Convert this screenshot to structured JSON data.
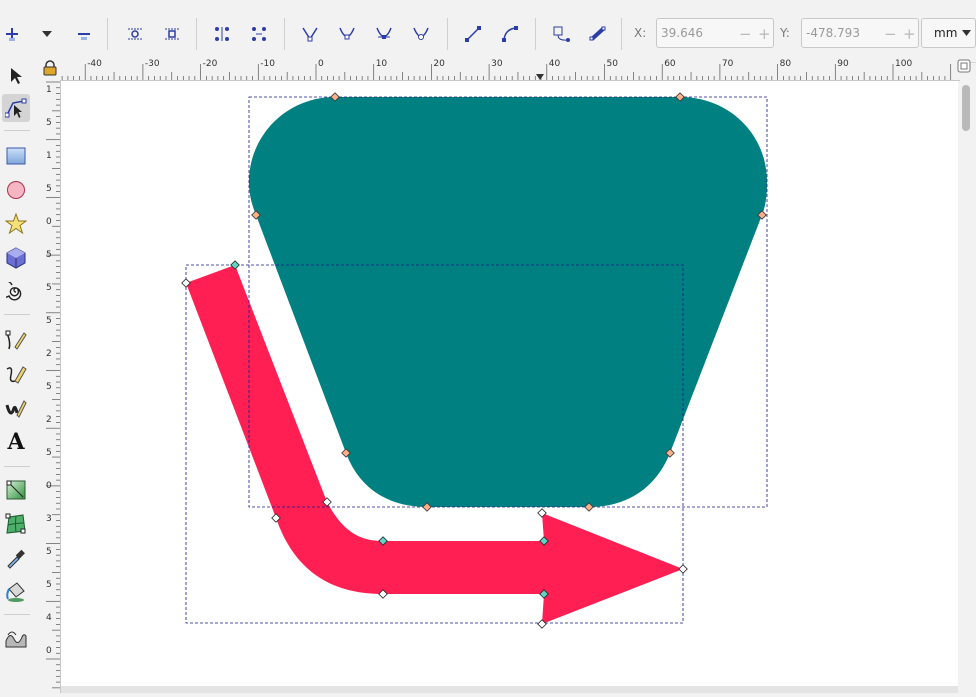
{
  "toolbar": {
    "x_label": "X:",
    "x_value": "39.646",
    "y_label": "Y:",
    "y_value": "-478.793",
    "unit": "mm",
    "buttons": [
      "insert-node",
      "dropdown",
      "delete-node",
      "join-nodes",
      "break-path",
      "join-segment",
      "delete-segment",
      "make-cusp",
      "make-smooth",
      "make-symmetric",
      "make-auto-smooth",
      "make-line",
      "make-curve",
      "object-to-path",
      "stroke-to-path"
    ]
  },
  "rulers": {
    "horizontal_labels": [
      "-40",
      "-30",
      "-20",
      "-10",
      "0",
      "10",
      "20",
      "30",
      "40",
      "50",
      "60",
      "70",
      "80",
      "90",
      "100"
    ],
    "vertical_labels": [
      "1",
      "5",
      "1",
      "5",
      "0",
      "5",
      "5",
      "5",
      "2",
      "5",
      "2",
      "5",
      "0",
      "3",
      "5",
      "5",
      "4",
      "0"
    ]
  },
  "tools": [
    {
      "name": "selector-tool",
      "active": false
    },
    {
      "name": "node-tool",
      "active": true
    },
    {
      "name": "rectangle-tool",
      "active": false
    },
    {
      "name": "ellipse-tool",
      "active": false
    },
    {
      "name": "star-tool",
      "active": false
    },
    {
      "name": "3d-box-tool",
      "active": false
    },
    {
      "name": "spiral-tool",
      "active": false
    },
    {
      "name": "pen-tool",
      "active": false
    },
    {
      "name": "pencil-tool",
      "active": false
    },
    {
      "name": "calligraphy-tool",
      "active": false
    },
    {
      "name": "text-tool",
      "active": false
    },
    {
      "name": "gradient-tool",
      "active": false
    },
    {
      "name": "mesh-tool",
      "active": false
    },
    {
      "name": "dropper-tool",
      "active": false
    },
    {
      "name": "paint-bucket-tool",
      "active": false
    },
    {
      "name": "tweak-tool",
      "active": false
    }
  ],
  "text_tool_glyph": "A",
  "colors": {
    "teal_shape": "#008080",
    "arrow_shape": "#ff1f52",
    "selection_dash": "#1a1a8c",
    "node_fill": "#ffffff",
    "node_selected": "#62d2c4"
  }
}
